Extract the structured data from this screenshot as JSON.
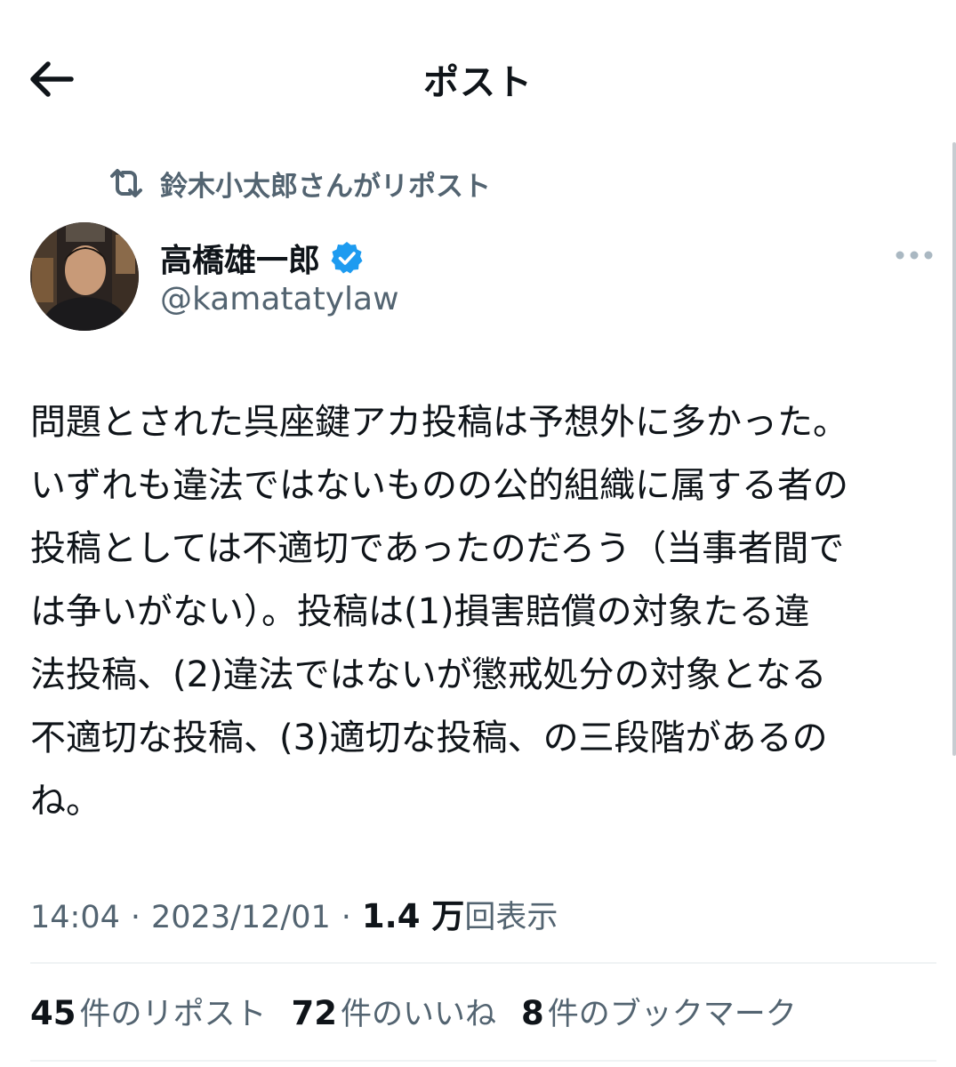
{
  "header": {
    "title": "ポスト"
  },
  "repost": {
    "text": "鈴木小太郎さんがリポスト"
  },
  "author": {
    "name": "高橋雄一郎",
    "handle": "@kamatatylaw"
  },
  "post": {
    "lines": [
      "問題とされた呉座鍵アカ投稿は予想外に多かった。",
      "いずれも違法ではないものの公的組織に属する者の",
      "投稿としては不適切であったのだろう（当事者間で",
      "は争いがない）。投稿は(1)損害賠償の対象たる違",
      "法投稿、(2)違法ではないが懲戒処分の対象となる",
      "不適切な投稿、(3)適切な投稿、の三段階があるの",
      "ね。"
    ]
  },
  "meta": {
    "time": "14:04",
    "date": "2023/12/01",
    "separator": "·",
    "views_count": "1.4 万",
    "views_label": "回表示"
  },
  "stats": {
    "reposts_count": "45",
    "reposts_label": "件のリポスト",
    "likes_count": "72",
    "likes_label": "件のいいね",
    "bookmarks_count": "8",
    "bookmarks_label": "件のブックマーク"
  },
  "colors": {
    "text": "#0f1419",
    "secondary": "#536471",
    "verified": "#1d9bf0",
    "divider": "#eff3f4"
  }
}
